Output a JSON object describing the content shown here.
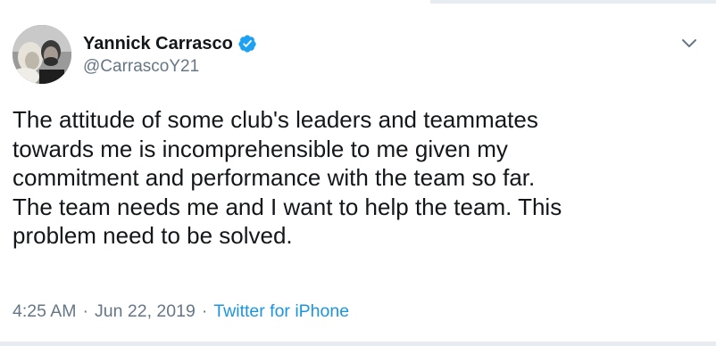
{
  "tweet": {
    "author": {
      "display_name": "Yannick Carrasco",
      "handle": "@CarrascoY21",
      "verified": true
    },
    "text": "The attitude of some club's leaders and teammates\ntowards me is incomprehensible to me given my\ncommitment and performance with the team so far.\nThe team needs me and I want to help the team. This\nproblem need to be solved.",
    "time": "4:25 AM",
    "separator": "·",
    "date": "Jun 22, 2019",
    "source": "Twitter for iPhone"
  },
  "icons": {
    "verified": "verified-badge-icon",
    "more": "chevron-down-icon"
  },
  "colors": {
    "text": "#14171a",
    "secondary": "#657786",
    "accent": "#1b95e0",
    "divider": "#e6ecf0"
  }
}
